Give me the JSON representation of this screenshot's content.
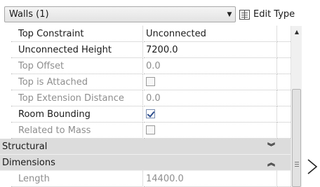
{
  "header": {
    "type_selector": "Walls (1)",
    "edit_type_label": "Edit Type"
  },
  "properties": [
    {
      "name": "Top Constraint",
      "value": "Unconnected",
      "kind": "text",
      "enabled": true
    },
    {
      "name": "Unconnected Height",
      "value": "7200.0",
      "kind": "text",
      "enabled": true
    },
    {
      "name": "Top Offset",
      "value": "0.0",
      "kind": "text",
      "enabled": false
    },
    {
      "name": "Top is Attached",
      "value": "",
      "kind": "checkbox",
      "checked": false,
      "enabled": false
    },
    {
      "name": "Top Extension Distance",
      "value": "0.0",
      "kind": "text",
      "enabled": false
    },
    {
      "name": "Room Bounding",
      "value": "",
      "kind": "checkbox",
      "checked": true,
      "enabled": true
    },
    {
      "name": "Related to Mass",
      "value": "",
      "kind": "checkbox",
      "checked": false,
      "enabled": false
    }
  ],
  "groups": {
    "structural": {
      "label": "Structural",
      "state": "collapsed"
    },
    "dimensions": {
      "label": "Dimensions",
      "state": "expanded"
    }
  },
  "dimensions_rows": [
    {
      "name": "Length",
      "value": "14400.0",
      "kind": "text",
      "enabled": false
    }
  ]
}
